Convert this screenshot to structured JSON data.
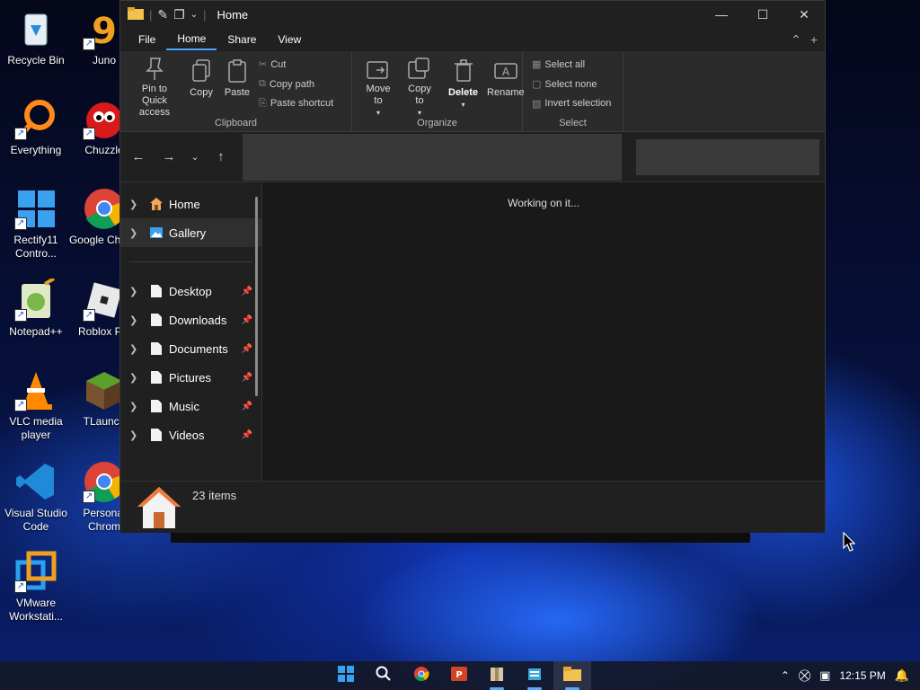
{
  "desktop": {
    "icons": [
      {
        "label": "Recycle Bin"
      },
      {
        "label": "Juno"
      },
      {
        "label": "Everything"
      },
      {
        "label": "Chuzzle"
      },
      {
        "label": "Rectify11 Contro..."
      },
      {
        "label": "Google Chrom"
      },
      {
        "label": "Notepad++"
      },
      {
        "label": "Roblox Pla"
      },
      {
        "label": "VLC media player"
      },
      {
        "label": "TLaunch"
      },
      {
        "label": "Visual Studio Code"
      },
      {
        "label": "Personal Chrom"
      },
      {
        "label": "VMware Workstati..."
      }
    ]
  },
  "window": {
    "title": "Home",
    "menu": {
      "file": "File",
      "home": "Home",
      "share": "Share",
      "view": "View"
    },
    "ribbon": {
      "pin": "Pin to Quick access",
      "copy": "Copy",
      "paste": "Paste",
      "cut": "Cut",
      "copy_path": "Copy path",
      "paste_shortcut": "Paste shortcut",
      "clipboard_label": "Clipboard",
      "move_to": "Move to",
      "copy_to": "Copy to",
      "delete": "Delete",
      "rename": "Rename",
      "organize_label": "Organize",
      "select_all": "Select all",
      "select_none": "Select none",
      "invert_selection": "Invert selection",
      "select_label": "Select"
    },
    "sidebar": {
      "home": "Home",
      "gallery": "Gallery",
      "desktop": "Desktop",
      "downloads": "Downloads",
      "documents": "Documents",
      "pictures": "Pictures",
      "music": "Music",
      "videos": "Videos"
    },
    "content": {
      "working": "Working on it..."
    },
    "status": {
      "items": "23 items"
    }
  },
  "taskbar": {
    "time": "12:15 PM"
  }
}
